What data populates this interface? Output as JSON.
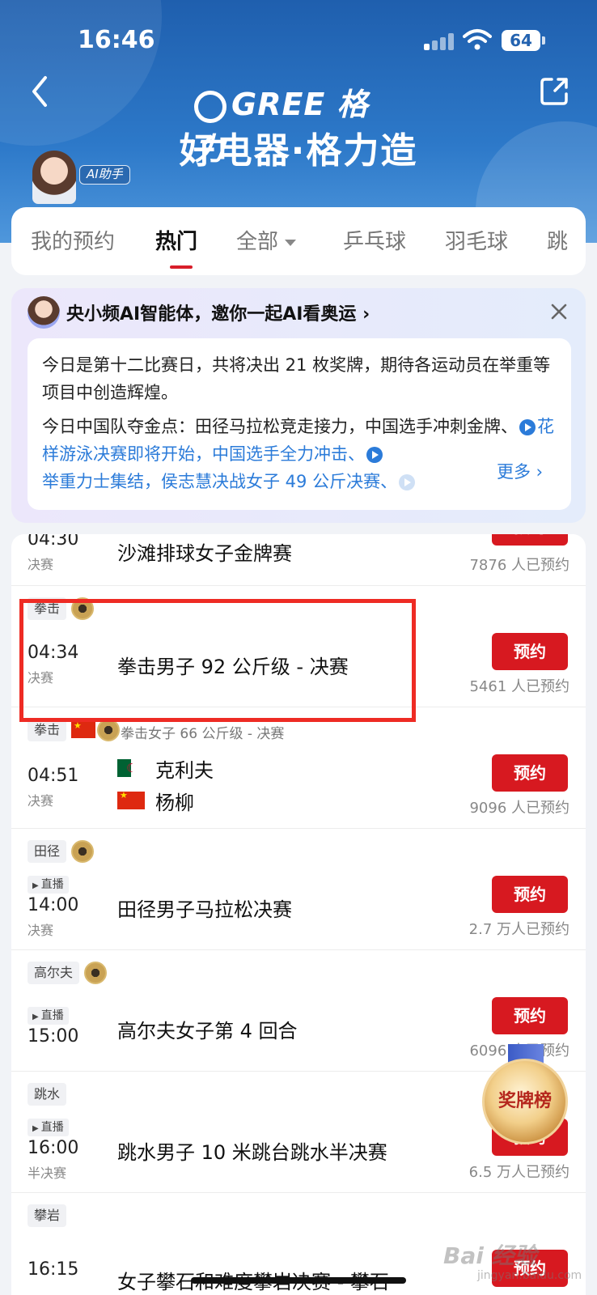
{
  "status_bar": {
    "time": "16:46",
    "battery": "64"
  },
  "header": {
    "brand": "GREE 格力",
    "slogan": "好电器·格力造",
    "ai_badge": "AI助手"
  },
  "tabs": [
    {
      "label": "我的预约"
    },
    {
      "label": "热门",
      "active": true
    },
    {
      "label": "全部"
    },
    {
      "label": "乒乓球"
    },
    {
      "label": "羽毛球"
    },
    {
      "label": "跳"
    }
  ],
  "ai_card": {
    "title": "央小频AI智能体，邀你一起AI看奥运 ›",
    "para1": "今日是第十二比赛日，共将决出 21 枚奖牌，期待各运动员在举重等项目中创造辉煌。",
    "para2_prefix": "今日中国队夺金点：田径马拉松竞走接力，中国选手冲刺金牌、",
    "link1": "花样游泳决赛即将开始，中国选手全力冲击、",
    "link2": "举重力士集结，侯志慧决战女子 49 公斤决赛、",
    "more": "更多 ›"
  },
  "rows": [
    {
      "time": "04:30",
      "stage": "决赛",
      "title": "沙滩排球女子金牌赛",
      "button": "预约",
      "count": "7876 人已预约"
    },
    {
      "tag": "拳击",
      "time": "04:34",
      "stage": "决赛",
      "title": "拳击男子 92 公斤级 - 决赛",
      "button": "预约",
      "count": "5461 人已预约"
    },
    {
      "tag": "拳击",
      "subtitle": "拳击女子 66 公斤级 - 决赛",
      "time": "04:51",
      "stage": "决赛",
      "player1": "克利夫",
      "player2": "杨柳",
      "button": "预约",
      "count": "9096 人已预约"
    },
    {
      "tag": "田径",
      "live": "直播",
      "time": "14:00",
      "stage": "决赛",
      "title": "田径男子马拉松决赛",
      "button": "预约",
      "count": "2.7 万人已预约"
    },
    {
      "tag": "高尔夫",
      "live": "直播",
      "time": "15:00",
      "title": "高尔夫女子第 4 回合",
      "button": "预约",
      "count": "6096 人已预约"
    },
    {
      "tag": "跳水",
      "live": "直播",
      "time": "16:00",
      "stage": "半决赛",
      "title": "跳水男子 10 米跳台跳水半决赛",
      "button": "预约",
      "count": "6.5 万人已预约"
    },
    {
      "tag": "攀岩",
      "time": "16:15",
      "title": "女子攀石和难度攀岩决赛 - 攀石",
      "button": "预约"
    }
  ],
  "medal_board": "奖牌榜",
  "watermark": "Bai 经验",
  "watermark_sub": "jingyan.baidu.com",
  "colors": {
    "accent": "#d71920",
    "link": "#2b7bd9",
    "header": "#2463b0"
  }
}
